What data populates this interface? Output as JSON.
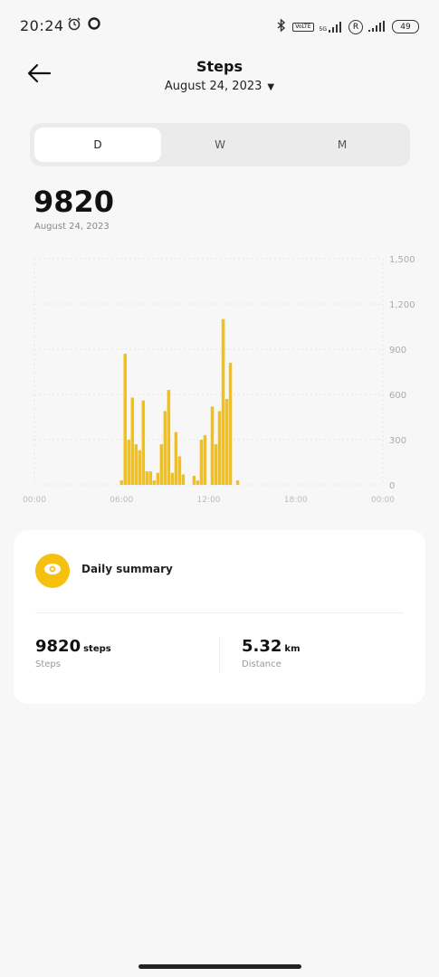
{
  "status_bar": {
    "time": "20:24",
    "network_tag": "5G",
    "lte_tag": "VoLTE",
    "roaming_symbol": "R",
    "battery": "49"
  },
  "header": {
    "title": "Steps",
    "date": "August 24, 2023"
  },
  "tabs": [
    {
      "label": "D",
      "active": true
    },
    {
      "label": "W",
      "active": false
    },
    {
      "label": "M",
      "active": false
    }
  ],
  "summary": {
    "total": "9820",
    "date": "August 24, 2023"
  },
  "chart_data": {
    "type": "bar",
    "x_ticks": [
      "00:00",
      "06:00",
      "12:00",
      "18:00",
      "00:00"
    ],
    "y_ticks": [
      "0",
      "300",
      "600",
      "900",
      "1,200",
      "1,500"
    ],
    "ylim": [
      0,
      1500
    ],
    "xlim_hours": [
      0,
      24
    ],
    "bar_color": "#f5c010",
    "hours": [
      6.0,
      6.25,
      6.5,
      6.75,
      7.0,
      7.25,
      7.5,
      7.75,
      8.0,
      8.25,
      8.5,
      8.75,
      9.0,
      9.25,
      9.5,
      9.75,
      10.0,
      10.25,
      11.0,
      11.25,
      11.5,
      11.75,
      12.25,
      12.5,
      12.75,
      13.0,
      13.25,
      13.5,
      14.0,
      14.25,
      14.5,
      14.75,
      15.0,
      15.25,
      15.5,
      15.75
    ],
    "values": [
      30,
      870,
      300,
      580,
      270,
      230,
      560,
      90,
      90,
      30,
      80,
      270,
      490,
      630,
      80,
      350,
      190,
      70,
      60,
      30,
      300,
      330,
      520,
      270,
      490,
      1100,
      570,
      810,
      30,
      0,
      0,
      0,
      0,
      0,
      0,
      0
    ]
  },
  "daily_summary": {
    "title": "Daily summary",
    "steps_value": "9820",
    "steps_unit": "steps",
    "steps_label": "Steps",
    "distance_value": "5.32",
    "distance_unit": "km",
    "distance_label": "Distance"
  }
}
